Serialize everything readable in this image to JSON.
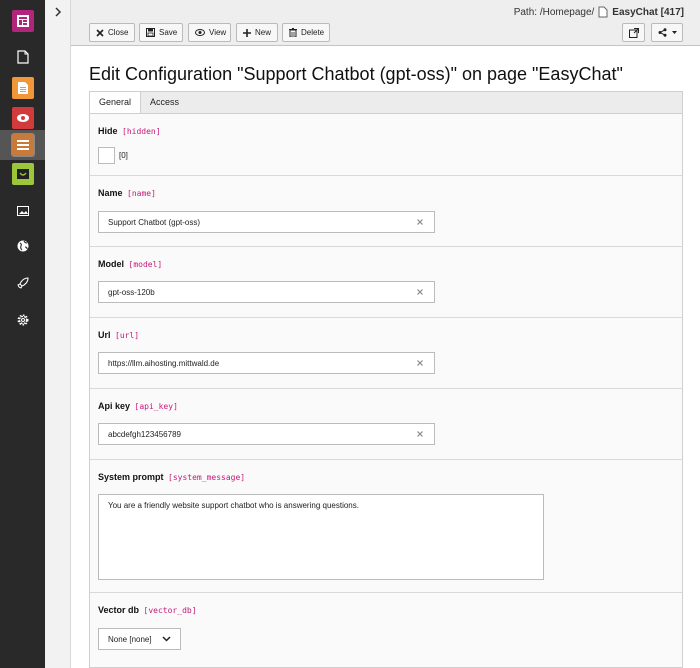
{
  "header": {
    "path_label": "Path: /Homepage/",
    "page_title": "EasyChat [417]",
    "buttons": {
      "close": "Close",
      "save": "Save",
      "view": "View",
      "new": "New",
      "delete": "Delete"
    }
  },
  "modules": [
    {
      "name": "page",
      "color": "#ffffff"
    },
    {
      "name": "list",
      "color": "#f0973a"
    },
    {
      "name": "view",
      "color": "#d23b3b"
    },
    {
      "name": "records",
      "color": "#c77a3a"
    },
    {
      "name": "easychat",
      "color": "#9dc73b"
    }
  ],
  "form": {
    "title": "Edit Configuration \"Support Chatbot (gpt-oss)\" on page \"EasyChat\"",
    "tabs": [
      "General",
      "Access"
    ],
    "hide": {
      "label": "Hide",
      "code": "[hidden]",
      "value": "[0]"
    },
    "name": {
      "label": "Name",
      "code": "[name]",
      "value": "Support Chatbot (gpt-oss)"
    },
    "model": {
      "label": "Model",
      "code": "[model]",
      "value": "gpt-oss-120b"
    },
    "url": {
      "label": "Url",
      "code": "[url]",
      "value": "https://llm.aihosting.mittwald.de"
    },
    "api_key": {
      "label": "Api key",
      "code": "[api_key]",
      "value": "abcdefgh123456789"
    },
    "system_prompt": {
      "label": "System prompt",
      "code": "[system_message]",
      "value": "You are a friendly website support chatbot who is answering questions."
    },
    "vector_db": {
      "label": "Vector db",
      "code": "[vector_db]",
      "value": "None [none]"
    }
  },
  "colors": {
    "accent_label": "#c6187c",
    "module_bar": "#292929"
  }
}
